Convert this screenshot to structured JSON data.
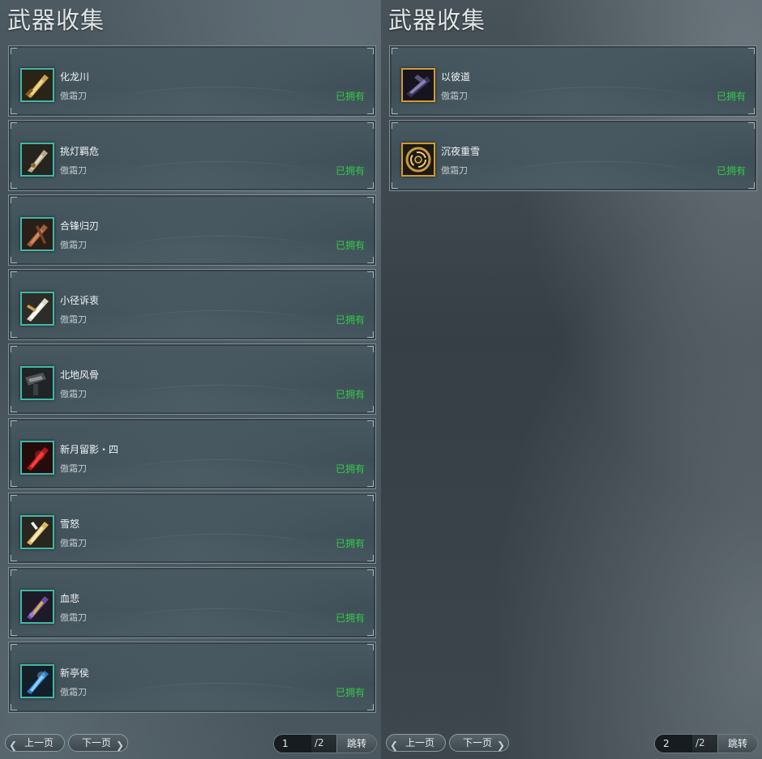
{
  "left_panel": {
    "title": "武器收集",
    "items": [
      {
        "name": "化龙川",
        "type": "傲霜刀",
        "status": "已拥有",
        "icon": "gold-dragon-blade-icon",
        "frame": "teal"
      },
      {
        "name": "挑灯羁危",
        "type": "傲霜刀",
        "status": "已拥有",
        "icon": "lantern-blade-icon",
        "frame": "teal"
      },
      {
        "name": "合锋归刃",
        "type": "傲霜刀",
        "status": "已拥有",
        "icon": "copper-blade-icon",
        "frame": "teal"
      },
      {
        "name": "小径诉衷",
        "type": "傲霜刀",
        "status": "已拥有",
        "icon": "white-gold-blade-icon",
        "frame": "teal"
      },
      {
        "name": "北地风骨",
        "type": "傲霜刀",
        "status": "已拥有",
        "icon": "dark-iron-blade-icon",
        "frame": "teal"
      },
      {
        "name": "新月留影・四",
        "type": "傲霜刀",
        "status": "已拥有",
        "icon": "crimson-blade-icon",
        "frame": "teal"
      },
      {
        "name": "雪怒",
        "type": "傲霜刀",
        "status": "已拥有",
        "icon": "snow-gold-blade-icon",
        "frame": "teal"
      },
      {
        "name": "血悲",
        "type": "傲霜刀",
        "status": "已拥有",
        "icon": "purple-gold-blade-icon",
        "frame": "teal"
      },
      {
        "name": "新亭侯",
        "type": "傲霜刀",
        "status": "已拥有",
        "icon": "ice-blue-blade-icon",
        "frame": "teal"
      }
    ],
    "pager": {
      "prev_label": "上一页",
      "next_label": "下一页",
      "page_value": "1",
      "page_total": "/2",
      "jump_label": "跳转"
    }
  },
  "right_panel": {
    "title": "武器收集",
    "items": [
      {
        "name": "以彼道",
        "type": "傲霜刀",
        "status": "已拥有",
        "icon": "dark-purple-blade-icon",
        "frame": "gold"
      },
      {
        "name": "沉夜重雪",
        "type": "傲霜刀",
        "status": "已拥有",
        "icon": "golden-vortex-icon",
        "frame": "gold"
      }
    ],
    "pager": {
      "prev_label": "上一页",
      "next_label": "下一页",
      "page_value": "2",
      "page_total": "/2",
      "jump_label": "跳转"
    }
  },
  "colors": {
    "owned_status": "#33c94a",
    "teal_frame": "#3fb8a8",
    "gold_frame": "#d39b32",
    "title_text": "#dfe4e6"
  }
}
